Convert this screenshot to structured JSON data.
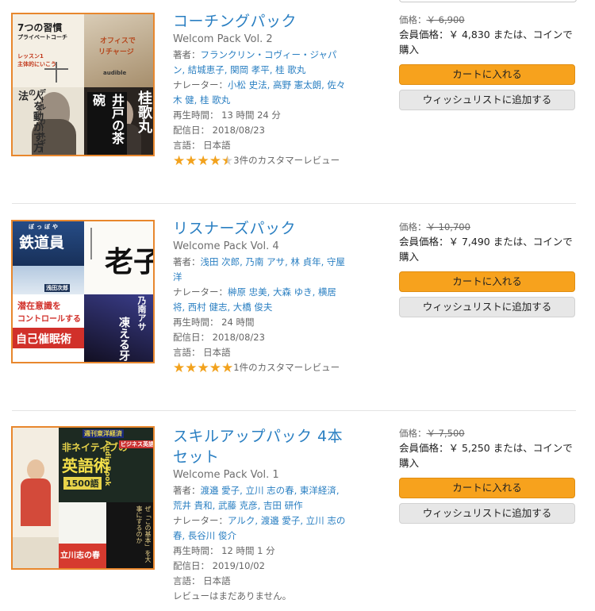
{
  "products": [
    {
      "title": "コーチングパック",
      "subtitle": "Welcom Pack Vol. 2",
      "authors_label": "著者：",
      "authors": "フランクリン・コヴィー・ジャパン, 結城恵子, 関岡 孝平, 桂 歌丸",
      "narrators_label": "ナレーター：",
      "narrators": "小松 史法, 高野 憲太朗, 佐々木 健, 桂 歌丸",
      "runtime": "再生時間： 13 時間 24 分",
      "release": "配信日： 2018/08/23",
      "language": "言語： 日本語",
      "rating": 4.5,
      "reviews": "3件のカスタマーレビュー",
      "price_label": "価格：",
      "list_price": "￥ 6,900",
      "member_price": "会員価格：￥ 4,830 または、コインで購入",
      "cart_label": "カートに入れる",
      "wishlist_label": "ウィッシュリストに追加する",
      "cover": {
        "tl_line1": "7つの習慣",
        "tl_line2": "プライベートコーチ",
        "tl_line3": "レッスン1",
        "tl_line4": "主体的にいこう",
        "tr_line1": "オフィスで",
        "tr_line2": "リチャージ",
        "tr_brand": "audible",
        "bl_vertical": "人を動かす方法",
        "bl_vertical2": "デール・カーネギーの",
        "br_vertical": "井戸の茶碗",
        "br_name": "桂歌丸"
      }
    },
    {
      "title": "リスナーズパック",
      "subtitle": "Welcome Pack Vol. 4",
      "authors_label": "著者：",
      "authors": "浅田 次郎, 乃南 アサ, 林 貞年, 守屋 洋",
      "narrators_label": "ナレーター：",
      "narrators": "榊原 忠美, 大森 ゆき, 横居 将, 西村 健志, 大橋 俊夫",
      "runtime": "再生時間： 24 時間",
      "release": "配信日： 2018/08/23",
      "language": "言語： 日本語",
      "rating": 5,
      "reviews": "1件のカスタマーレビュー",
      "price_label": "価格：",
      "list_price": "￥ 10,700",
      "member_price": "会員価格：￥ 7,490 または、コインで購入",
      "cart_label": "カートに入れる",
      "wishlist_label": "ウィッシュリストに追加する",
      "cover": {
        "tl_title": "鉄道員",
        "tl_kana": "ぽっぽや",
        "tl_author": "浅田次郎",
        "tr_title": "老子",
        "bl_line1": "潜在意識を",
        "bl_line2": "コントロールする",
        "bl_line3": "自己催眠術",
        "br_author": "乃南アサ",
        "br_title": "凍える牙"
      }
    },
    {
      "title": "スキルアップパック 4本セット",
      "subtitle": "Welcome Pack Vol. 1",
      "authors_label": "著者：",
      "authors": "渡邉 愛子, 立川 志の春, 東洋経済, 荒井 貴和, 武藤 克彦, 吉田 研作",
      "narrators_label": "ナレーター：",
      "narrators": "アルク, 渡邉 愛子, 立川 志の春, 長谷川 俊介",
      "runtime": "再生時間： 12 時間 1 分",
      "release": "配信日： 2019/10/02",
      "language": "言語： 日本語",
      "no_reviews": "レビューはまだありません。",
      "price_label": "価格：",
      "list_price": "￥ 7,500",
      "member_price": "会員価格：￥ 5,250 または、コインで購入",
      "cart_label": "カートに入れる",
      "wishlist_label": "ウィッシュリストに追加する",
      "cover": {
        "tm_brand": "週刊東洋経済",
        "tm_title1": "非ネイティブの",
        "tm_title2": "英語術",
        "tm_badge": "1500語",
        "tm_series": "ビジネス英語",
        "tm_vertical": "Audio Book",
        "bl_text": "立川志の春",
        "br_text": "世界のエリートはなぜ「この基本」を大事にするのか"
      }
    }
  ],
  "colors": {
    "link": "#2a7fc2",
    "cart_button": "#f7a21d",
    "wishlist_button": "#e7e7e7",
    "star": "#f2a21d",
    "cover_border": "#e8872d"
  }
}
